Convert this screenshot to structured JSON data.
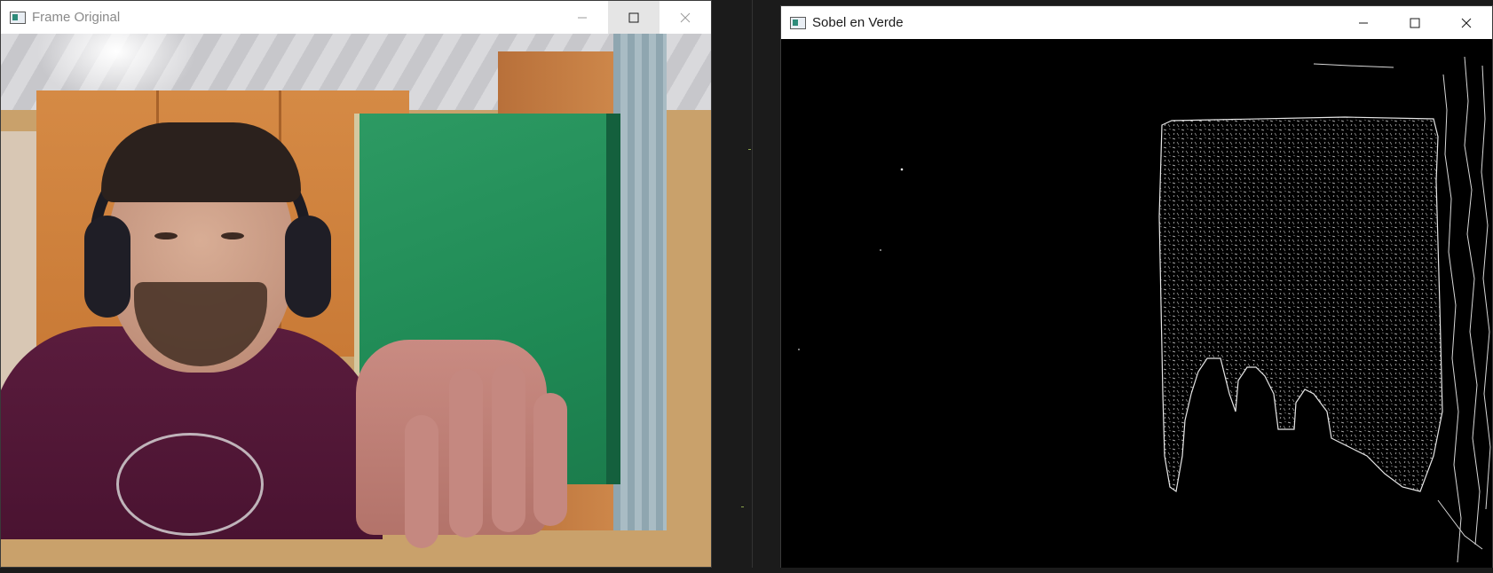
{
  "windows": [
    {
      "id": "frame-original",
      "title": "Frame Original",
      "active": false
    },
    {
      "id": "sobel-en-verde",
      "title": "Sobel en Verde",
      "active": true
    }
  ],
  "icons": {
    "app": "opencv-window-icon",
    "minimize": "minimize-icon",
    "maximize": "maximize-icon",
    "close": "close-icon"
  },
  "colors": {
    "titlebar": "#ffffff",
    "book_green": "#1f8a55",
    "edge_white": "#ffffff",
    "background": "#000000"
  }
}
